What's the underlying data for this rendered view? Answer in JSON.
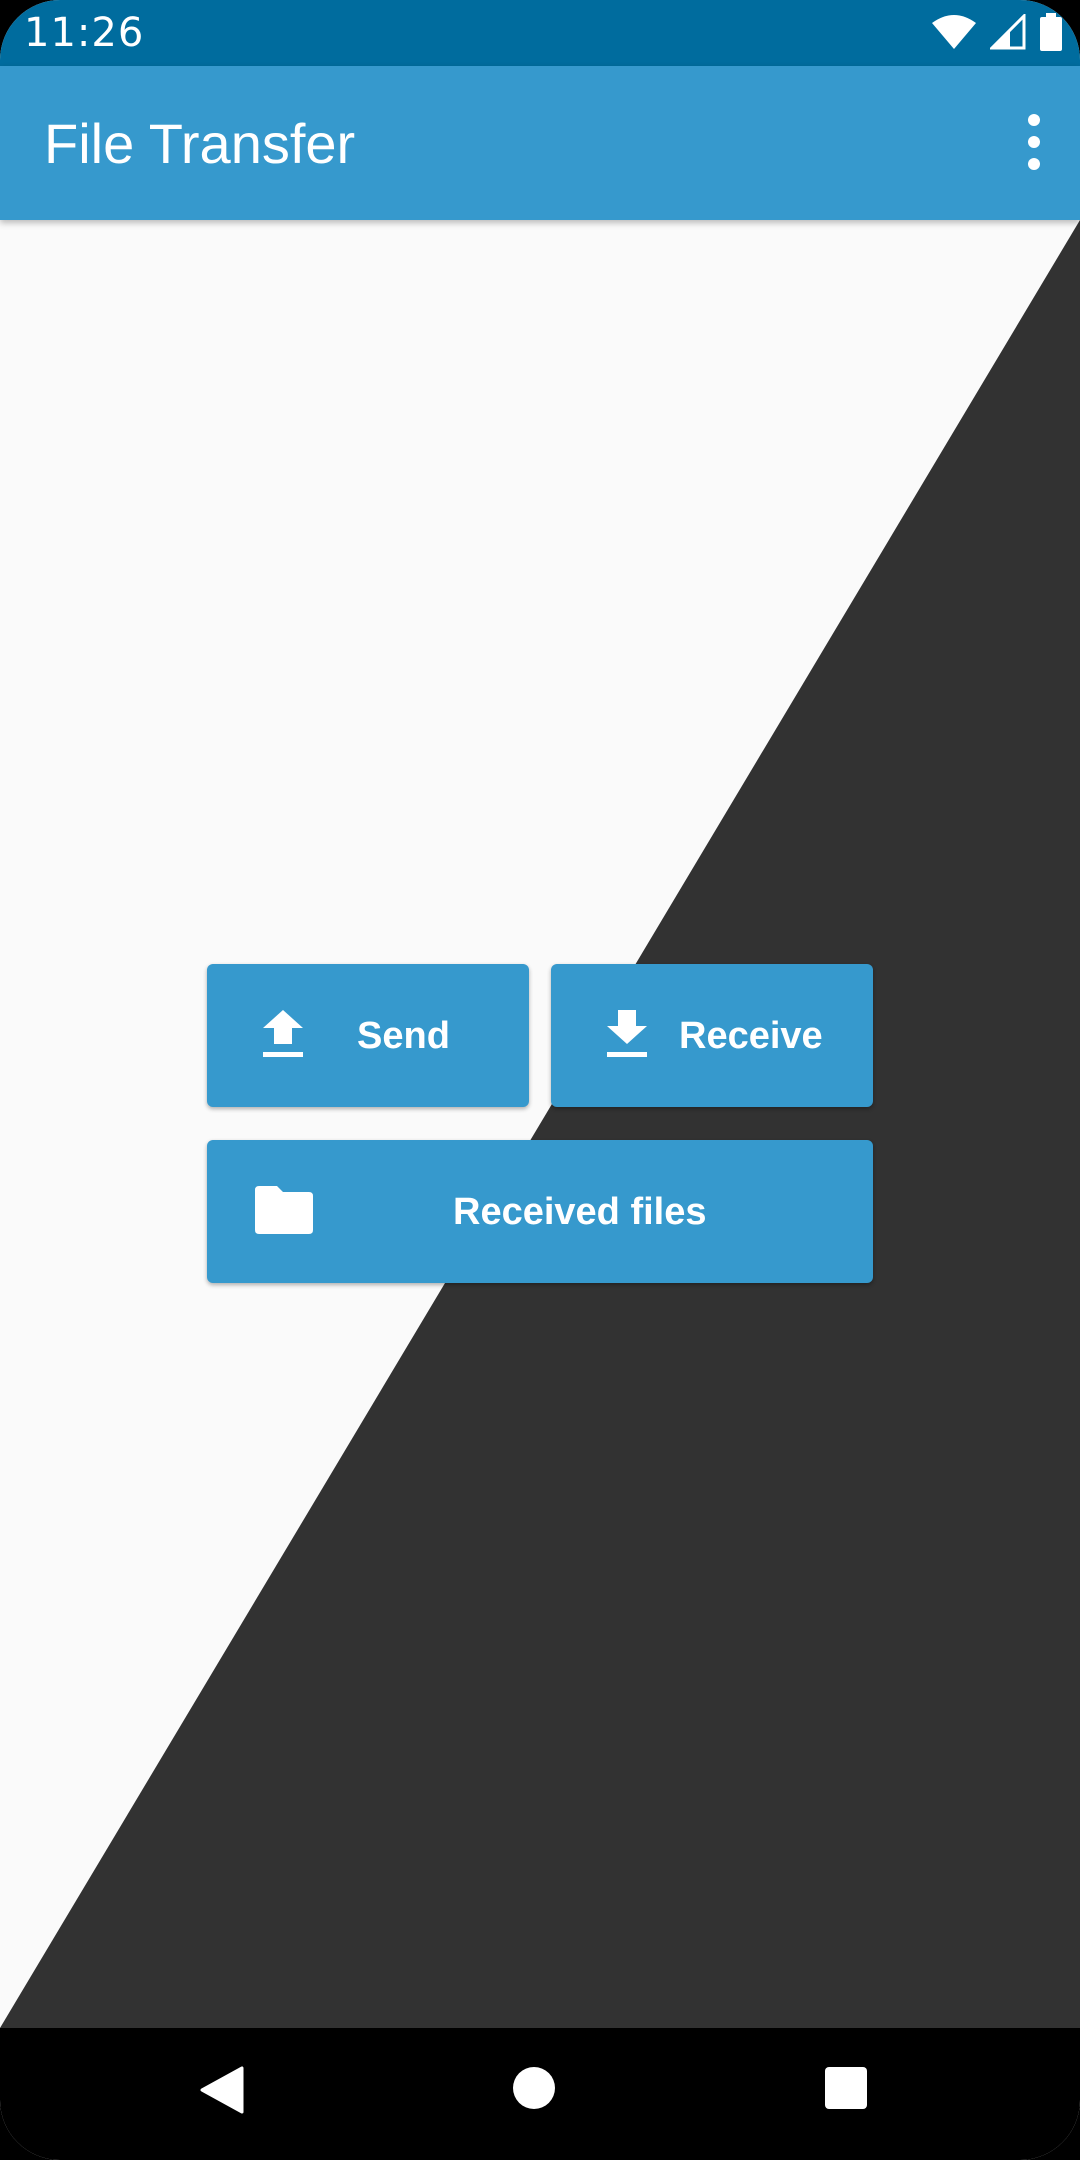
{
  "status_bar": {
    "time": "11:26",
    "icons": [
      "wifi-icon",
      "signal-icon",
      "battery-icon"
    ]
  },
  "app_bar": {
    "title": "File Transfer",
    "menu_icon": "more-vert-icon"
  },
  "actions": {
    "send": {
      "label": "Send",
      "icon": "upload-icon"
    },
    "receive": {
      "label": "Receive",
      "icon": "download-icon"
    },
    "received_files": {
      "label": "Received files",
      "icon": "folder-icon"
    }
  },
  "navigation": {
    "back_icon": "back-icon",
    "home_icon": "home-icon",
    "recents_icon": "recents-icon"
  },
  "colors": {
    "status_bar": "#006c9e",
    "primary": "#3699cd",
    "background_light": "#fafafa",
    "background_dark": "#323232",
    "nav_bar": "#000000"
  }
}
